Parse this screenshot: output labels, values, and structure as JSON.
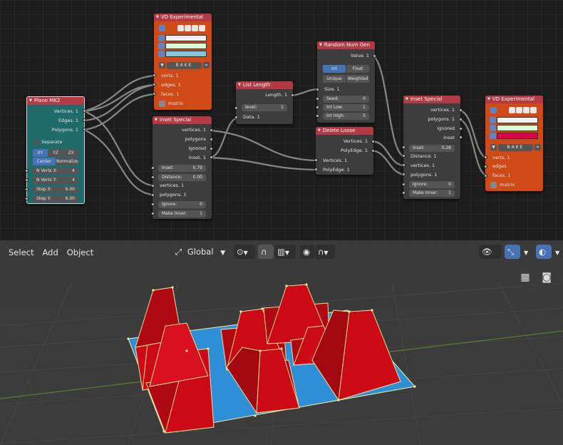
{
  "nodes": {
    "plane": {
      "title": "Plane MK2",
      "outputs": [
        "Vertices. 1",
        "Edges. 1",
        "Polygons. 1"
      ],
      "separate_label": "Separate",
      "direction_buttons": [
        "XY",
        "YZ",
        "ZX"
      ],
      "center_label": "Center",
      "normalize_label": "Normalize",
      "fields": [
        {
          "label": "N Verts X:",
          "value": "4"
        },
        {
          "label": "N Verts Y:",
          "value": "4"
        },
        {
          "label": "Step X:",
          "value": "6.00"
        },
        {
          "label": "Step Y:",
          "value": "6.00"
        }
      ]
    },
    "vd1": {
      "title": "VD Experimental",
      "bake_label": "BAKE",
      "inputs": [
        "verts. 1",
        "edges. 1",
        "faces. 1",
        "matrix"
      ]
    },
    "inset1": {
      "title": "Inset Special",
      "outputs": [
        "vertices. 1",
        "polygons",
        "ignored",
        "inset. 1"
      ],
      "fields": [
        {
          "label": "Inset:",
          "value": "0.79"
        },
        {
          "label": "Distance:",
          "value": "0.00"
        }
      ],
      "inputs": [
        "vertices. 1",
        "polygons. 1"
      ],
      "fields2": [
        {
          "label": "Ignore:",
          "value": "0"
        },
        {
          "label": "Make Inner:",
          "value": "1"
        }
      ]
    },
    "list_length": {
      "title": "List Length",
      "output": "Length. 1",
      "level_label": "level:",
      "level_value": "1",
      "input": "Data. 1"
    },
    "random": {
      "title": "Random Num Gen",
      "output": "Value. 1",
      "type_buttons": [
        "Int",
        "Float"
      ],
      "mode_buttons": [
        "Unique",
        "Weighted"
      ],
      "size_label": "Size. 1",
      "fields": [
        {
          "label": "Seed:",
          "value": "0"
        },
        {
          "label": "Int Low:",
          "value": "1"
        },
        {
          "label": "Int High:",
          "value": "5"
        }
      ]
    },
    "delete_loose": {
      "title": "Delete Loose",
      "outputs": [
        "Vertices. 1",
        "PolyEdge. 1"
      ],
      "inputs": [
        "Vertices. 1",
        "PolyEdge. 1"
      ]
    },
    "inset2": {
      "title": "Inset Special",
      "outputs": [
        "vertices. 1",
        "polygons. 1",
        "ignored",
        "inset"
      ],
      "inset_field": {
        "label": "Inset:",
        "value": "0.28"
      },
      "inputs": [
        "Distance. 1",
        "vertices. 1",
        "polygons. 1"
      ],
      "fields2": [
        {
          "label": "Ignore:",
          "value": "0"
        },
        {
          "label": "Make Inner:",
          "value": "1"
        }
      ]
    },
    "vd2": {
      "title": "VD Experimental",
      "bake_label": "BAKE",
      "inputs": [
        "verts. 1",
        "edges",
        "faces. 1",
        "matrix"
      ]
    }
  },
  "viewport_header": {
    "menus": [
      "Select",
      "Add",
      "Object"
    ],
    "transform_orientation": "Global"
  },
  "colors": {
    "node_header": "#b33a45",
    "teal_node": "#1f6b6a",
    "orange_node": "#cf4a16",
    "mesh_red": "#cc0a16",
    "mesh_blue": "#2e8fd6",
    "accent": "#4772b3"
  }
}
